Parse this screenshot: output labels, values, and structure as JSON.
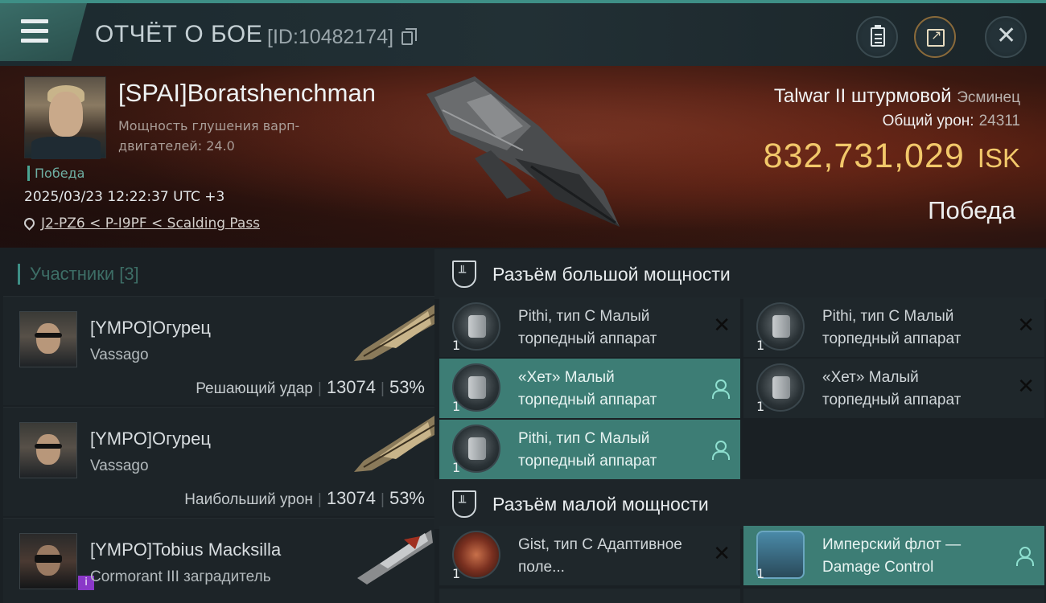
{
  "header": {
    "title": "ОТЧЁТ О БОЕ",
    "battle_id": "[ID:10482174]"
  },
  "victim": {
    "name": "[SPAI]Boratshenchman",
    "stat_label": "Мощность глушения варп-двигателей: 24.0",
    "result_tag": "Победа",
    "timestamp": "2025/03/23 12:22:37 UTC +3",
    "location": "J2-PZ6 < P-I9PF < Scalding Pass",
    "ship_name": "Talwar II штурмовой",
    "ship_class": "Эсминец",
    "damage_label": "Общий урон:",
    "damage_value": "24311",
    "isk_value": "832,731,029",
    "isk_unit": "ISK",
    "outcome": "Победа"
  },
  "participants": {
    "header": "Участники [3]",
    "rows": [
      {
        "name": "[YMPO]Огурец",
        "ship": "Vassago",
        "role": "Решающий удар",
        "damage": "13074",
        "percent": "53%"
      },
      {
        "name": "[YMPO]Огурец",
        "ship": "Vassago",
        "role": "Наибольший урон",
        "damage": "13074",
        "percent": "53%"
      },
      {
        "name": "[YMPO]Tobius Macksilla",
        "ship": "Cormorant III заградитель",
        "role": "",
        "damage": "",
        "percent": "",
        "badge": "i"
      }
    ]
  },
  "slots": {
    "high_header": "Разъём большой мощности",
    "low_header": "Разъём малой мощности",
    "high_modules": [
      {
        "name": "Pithi, тип C Малый торпедный аппарат",
        "qty": "1",
        "state": "destroyed"
      },
      {
        "name": "Pithi, тип C Малый торпедный аппарат",
        "qty": "1",
        "state": "destroyed"
      },
      {
        "name": "«Хет» Малый торпедный аппарат",
        "qty": "1",
        "state": "dropped"
      },
      {
        "name": "«Хет» Малый торпедный аппарат",
        "qty": "1",
        "state": "destroyed"
      },
      {
        "name": "Pithi, тип C Малый торпедный аппарат",
        "qty": "1",
        "state": "dropped"
      }
    ],
    "low_modules": [
      {
        "name": "Gist, тип C Адаптивное поле...",
        "qty": "1",
        "state": "destroyed"
      },
      {
        "name": "Имперский флот — Damage Control",
        "qty": "1",
        "state": "dropped"
      }
    ]
  },
  "icons": {
    "menu": "hamburger-menu-icon",
    "copy": "copy-icon",
    "clipboard": "clipboard-icon",
    "share": "share-icon",
    "close": "close-icon",
    "location": "location-pin-icon",
    "destroyed": "x-icon",
    "dropped": "person-icon",
    "slot": "slot-shield-icon"
  },
  "colors": {
    "accent": "#3e8f86",
    "isk": "#f2c86a",
    "selected_row": "#3d7d75"
  }
}
